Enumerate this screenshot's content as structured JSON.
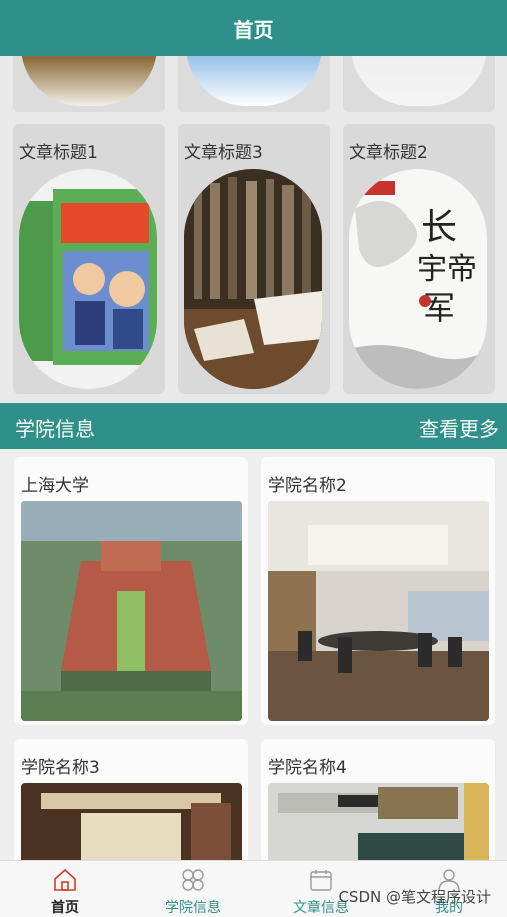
{
  "header": {
    "title": "首页"
  },
  "articles": [
    {
      "title": "文章标题1",
      "image": "comic-book-cover"
    },
    {
      "title": "文章标题3",
      "image": "old-books-library"
    },
    {
      "title": "文章标题2",
      "image": "calligraphy-book-cover"
    }
  ],
  "section": {
    "title": "学院信息",
    "more": "查看更多"
  },
  "colleges": [
    {
      "name": "上海大学",
      "image": "campus-aerial-view"
    },
    {
      "name": "学院名称2",
      "image": "conference-room"
    },
    {
      "name": "学院名称3",
      "image": "interior-room"
    },
    {
      "name": "学院名称4",
      "image": "classroom-projector"
    }
  ],
  "tabs": [
    {
      "label": "首页",
      "icon": "home-icon",
      "active": true
    },
    {
      "label": "学院信息",
      "icon": "grid-icon",
      "active": false
    },
    {
      "label": "文章信息",
      "icon": "calendar-icon",
      "active": false
    },
    {
      "label": "我的",
      "icon": "user-icon",
      "active": false
    }
  ],
  "watermark": "CSDN @笔文程序设计",
  "colors": {
    "primary": "#2e9088",
    "active_tab": "#d23c2c",
    "inactive_tab": "#2e9088"
  }
}
